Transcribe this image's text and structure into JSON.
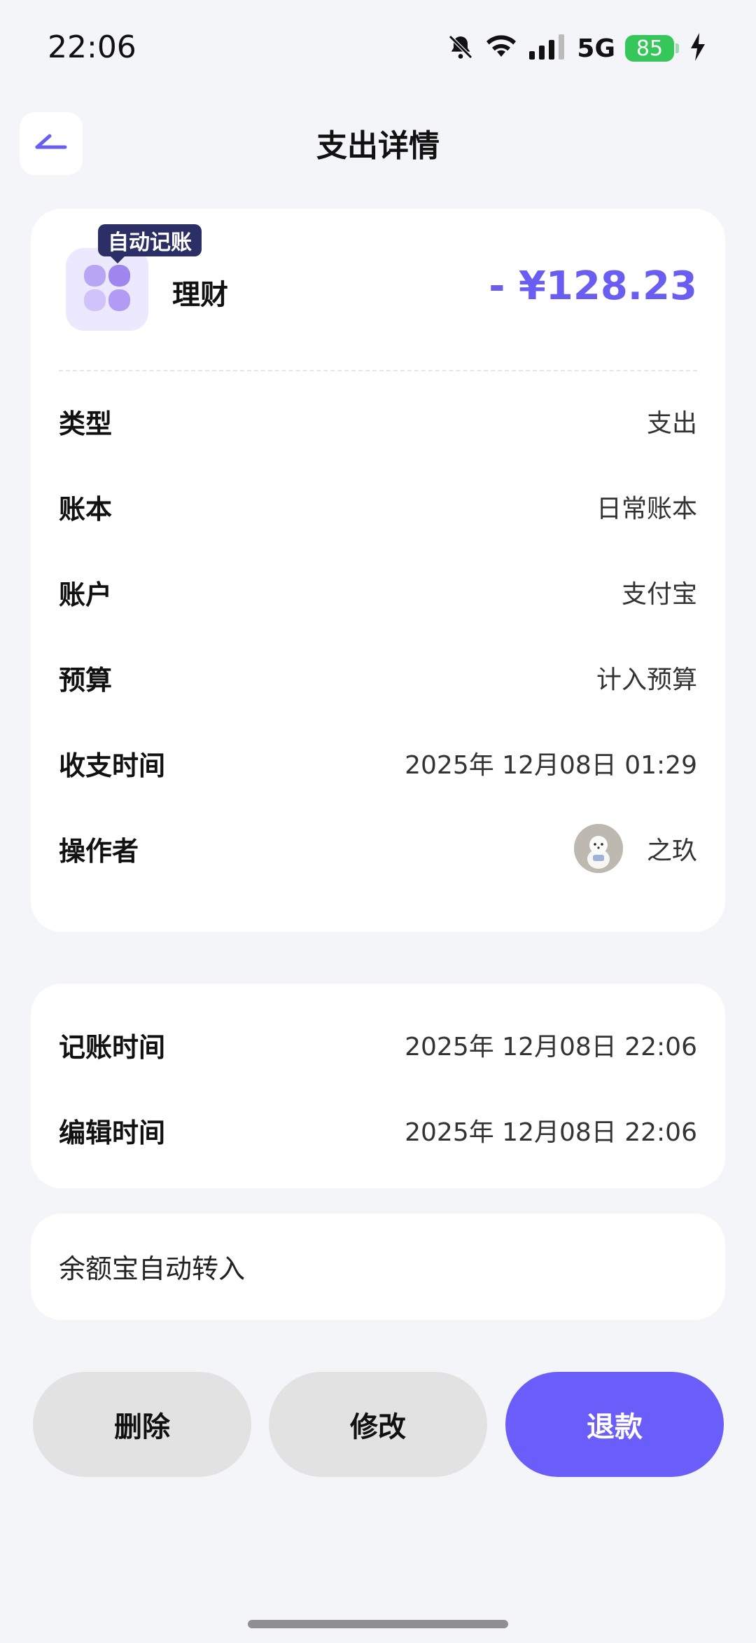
{
  "status_bar": {
    "time": "22:06",
    "network": "5G",
    "battery": "85",
    "icons": [
      "bell-off-icon",
      "wifi-icon",
      "signal-icon",
      "battery-icon",
      "charging-icon"
    ]
  },
  "header": {
    "title": "支出详情",
    "back_icon": "back-arrow-icon"
  },
  "colors": {
    "accent": "#6a5df2",
    "badge_bg": "#2b2f66",
    "background": "#f4f5f8"
  },
  "transaction": {
    "badge": "自动记账",
    "category": "理财",
    "category_icon": "clover-icon",
    "amount": "- ¥128.23",
    "fields": [
      {
        "label": "类型",
        "value": "支出"
      },
      {
        "label": "账本",
        "value": "日常账本"
      },
      {
        "label": "账户",
        "value": "支付宝"
      },
      {
        "label": "预算",
        "value": "计入预算"
      },
      {
        "label": "收支时间",
        "value": "2025年 12月08日 01:29"
      },
      {
        "label": "操作者",
        "value": "之玖"
      }
    ]
  },
  "timestamps": [
    {
      "label": "记账时间",
      "value": "2025年 12月08日 22:06"
    },
    {
      "label": "编辑时间",
      "value": "2025年 12月08日 22:06"
    }
  ],
  "note": "余额宝自动转入",
  "actions": {
    "delete": "删除",
    "edit": "修改",
    "refund": "退款"
  }
}
